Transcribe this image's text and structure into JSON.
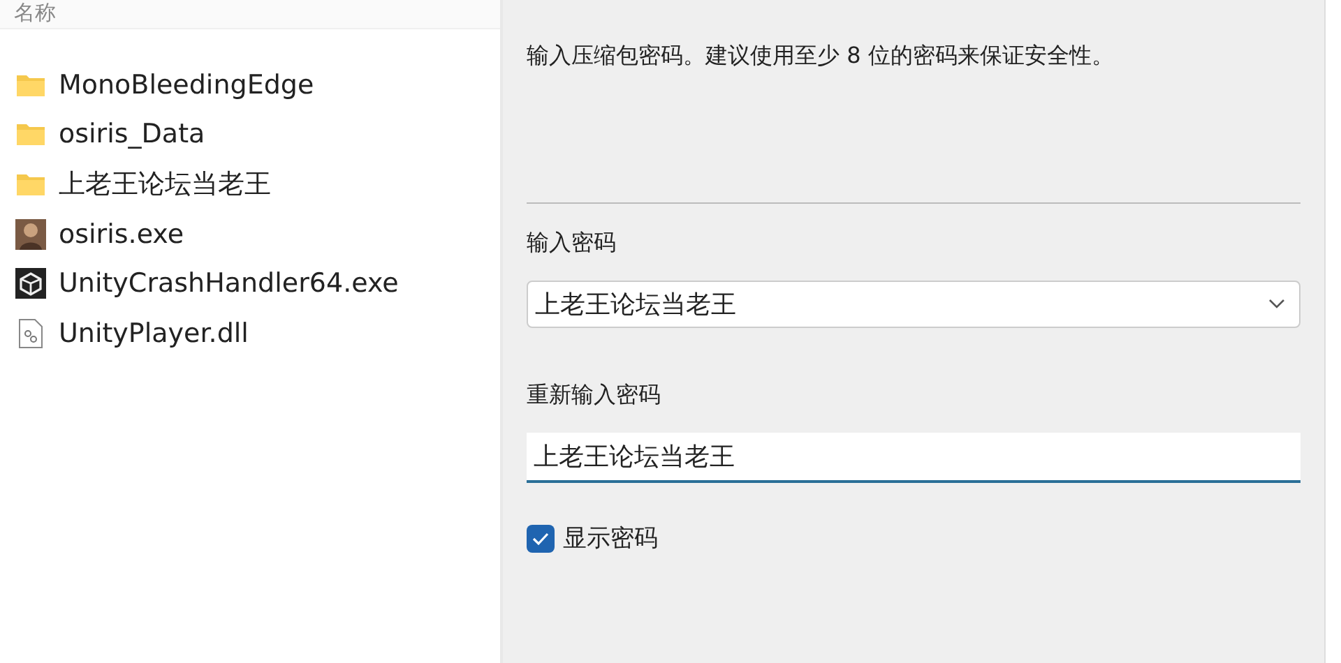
{
  "file_list": {
    "column_header": "名称",
    "items": [
      {
        "name": "MonoBleedingEdge",
        "kind": "folder"
      },
      {
        "name": "osiris_Data",
        "kind": "folder"
      },
      {
        "name": "上老王论坛当老王",
        "kind": "folder"
      },
      {
        "name": "osiris.exe",
        "kind": "app"
      },
      {
        "name": "UnityCrashHandler64.exe",
        "kind": "unity"
      },
      {
        "name": "UnityPlayer.dll",
        "kind": "dll"
      }
    ]
  },
  "dialog": {
    "description": "输入压缩包密码。建议使用至少 8 位的密码来保证安全性。",
    "password_label": "输入密码",
    "password_value": "上老王论坛当老王",
    "confirm_label": "重新输入密码",
    "confirm_value": "上老王论坛当老王",
    "show_password": {
      "label": "显示密码",
      "checked": true
    }
  }
}
